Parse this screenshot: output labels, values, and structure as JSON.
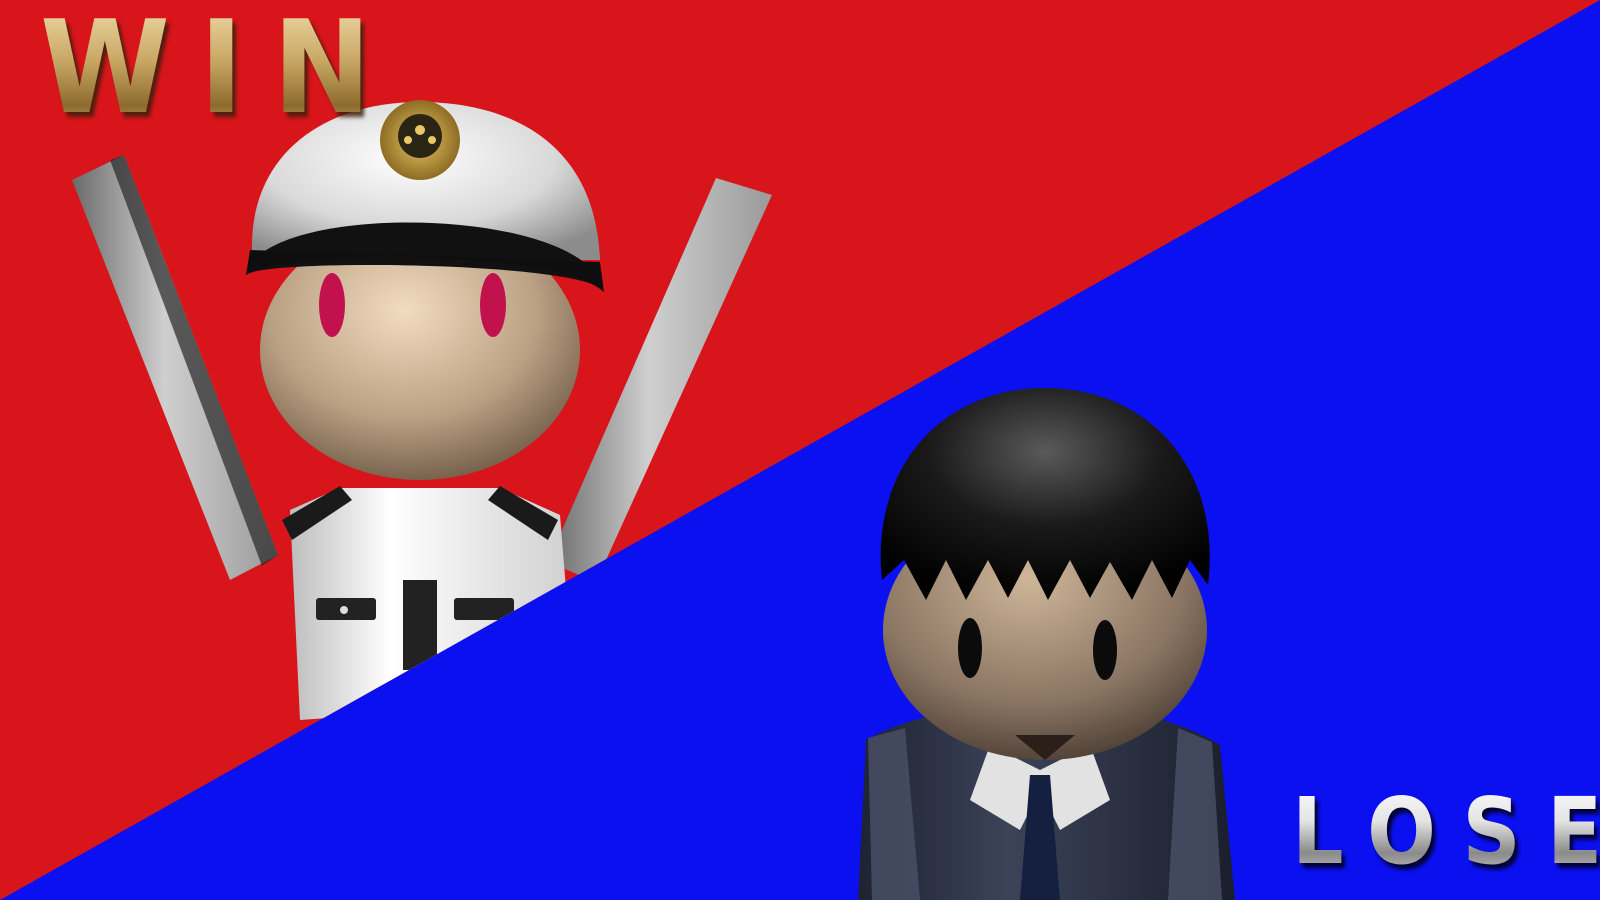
{
  "result_screen": {
    "win_label": "WIN",
    "lose_label": "LOSE"
  },
  "colors": {
    "win_background": "#d8151a",
    "lose_background": "#0a10f0",
    "win_text_gold": "#c8a764",
    "lose_text_silver": "#d6d6d6"
  },
  "characters": {
    "winner": "officer-character",
    "loser": "suit-character"
  }
}
